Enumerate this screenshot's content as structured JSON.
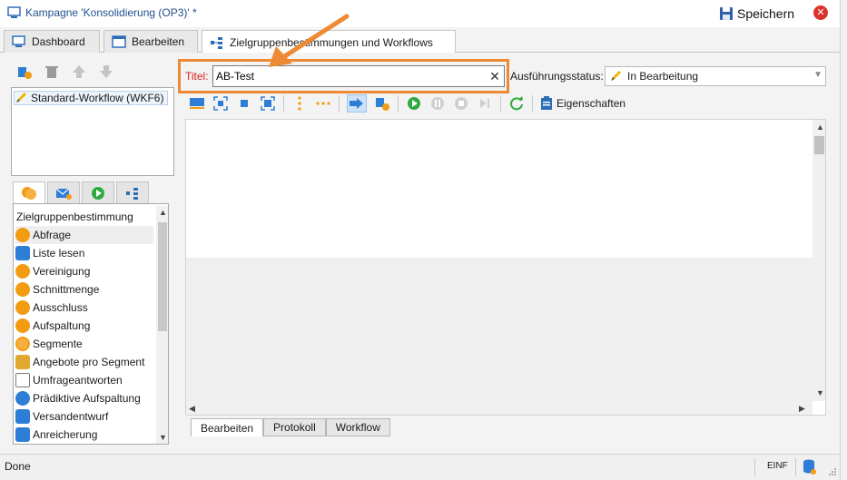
{
  "window": {
    "title": "Kampagne 'Konsolidierung (OP3)' *",
    "save_label": "Speichern"
  },
  "tabs": [
    {
      "label": "Dashboard"
    },
    {
      "label": "Bearbeiten"
    },
    {
      "label": "Zielgruppenbestimmungen und Workflows"
    }
  ],
  "workflows": {
    "items": [
      "Standard-Workflow (WKF6)"
    ]
  },
  "activities": {
    "heading": "Zielgruppenbestimmung",
    "items": [
      {
        "label": "Abfrage",
        "color": "#f39c12"
      },
      {
        "label": "Liste lesen",
        "color": "#2e7dd7"
      },
      {
        "label": "Vereinigung",
        "color": "#f39c12"
      },
      {
        "label": "Schnittmenge",
        "color": "#f39c12"
      },
      {
        "label": "Ausschluss",
        "color": "#f39c12"
      },
      {
        "label": "Aufspaltung",
        "color": "#f39c12"
      },
      {
        "label": "Segmente",
        "color": "#f39c12"
      },
      {
        "label": "Angebote pro Segment",
        "color": "#e0a82e"
      },
      {
        "label": "Umfrageantworten",
        "color": "#7a7a7a"
      },
      {
        "label": "Prädiktive Aufspaltung",
        "color": "#2e7dd7"
      },
      {
        "label": "Versandentwurf",
        "color": "#2e7dd7"
      },
      {
        "label": "Anreicherung",
        "color": "#2e7dd7"
      }
    ]
  },
  "editor": {
    "title_label": "Titel:",
    "title_value": "AB-Test",
    "exec_status_label": "Ausführungsstatus:",
    "exec_status_value": "In Bearbeitung",
    "properties_label": "Eigenschaften"
  },
  "bottom_tabs": [
    "Bearbeiten",
    "Protokoll",
    "Workflow"
  ],
  "status": {
    "text": "Done",
    "mode": "EINF"
  },
  "colors": {
    "highlight": "#ef8a34",
    "accent": "#2e7dd7",
    "required_label": "#d21f1f"
  }
}
